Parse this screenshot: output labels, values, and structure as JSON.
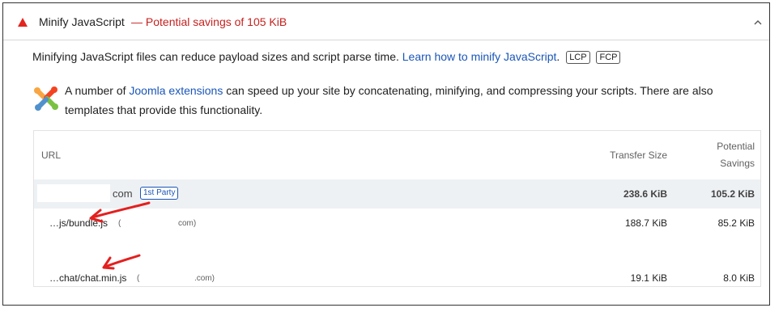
{
  "audit": {
    "title": "Minify JavaScript",
    "savings": "— Potential savings of 105 KiB",
    "description": "Minifying JavaScript files can reduce payload sizes and script parse time.",
    "learn_link": "Learn how to minify JavaScript",
    "period": ".",
    "chips": [
      "LCP",
      "FCP"
    ],
    "colors": {
      "fail": "#e3251e",
      "savings": "#c5221f",
      "link": "#1a56b8"
    }
  },
  "stack_pack": {
    "icon": "joomla-logo-icon",
    "text_before": "A number of ",
    "link": "Joomla extensions",
    "text_after": " can speed up your site by concatenating, minifying, and compressing your scripts. There are also templates that provide this functionality."
  },
  "table": {
    "headers": {
      "url": "URL",
      "transfer_size": "Transfer Size",
      "potential_savings": "Potential Savings"
    },
    "group": {
      "entity": "com",
      "badge": "1st Party",
      "transfer_size": "238.6 KiB",
      "savings": "105.2 KiB"
    },
    "rows": [
      {
        "url": "…js/bundle.js",
        "host_open": "(",
        "host": "com)",
        "transfer_size": "188.7 KiB",
        "savings": "85.2 KiB"
      },
      {
        "url": "…chat/chat.min.js",
        "host_open": "(",
        "host": ".com)",
        "transfer_size": "19.1 KiB",
        "savings": "8.0 KiB"
      }
    ]
  }
}
